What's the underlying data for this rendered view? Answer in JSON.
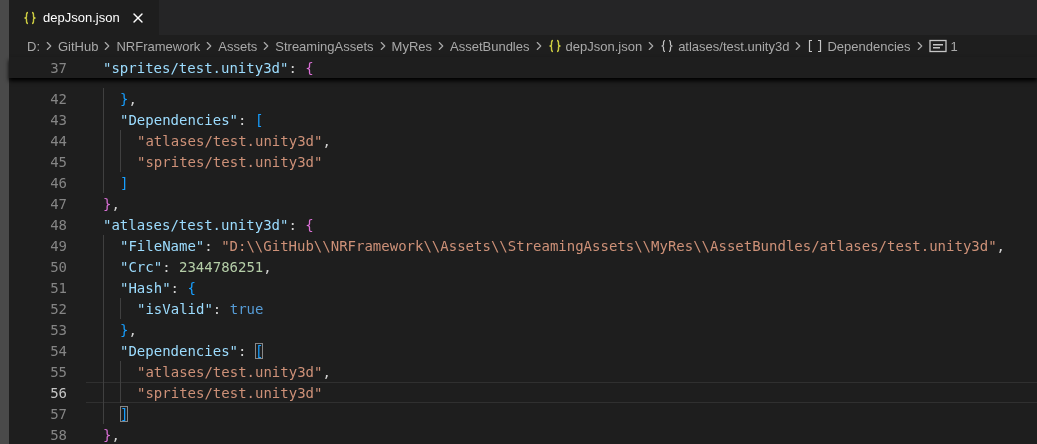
{
  "tab": {
    "title": "depJson.json",
    "selected": true
  },
  "breadcrumb": [
    {
      "kind": "folder",
      "label": "D:"
    },
    {
      "kind": "folder",
      "label": "GitHub"
    },
    {
      "kind": "folder",
      "label": "NRFramework"
    },
    {
      "kind": "folder",
      "label": "Assets"
    },
    {
      "kind": "folder",
      "label": "StreamingAssets"
    },
    {
      "kind": "folder",
      "label": "MyRes"
    },
    {
      "kind": "folder",
      "label": "AssetBundles"
    },
    {
      "kind": "file",
      "label": "depJson.json"
    },
    {
      "kind": "object",
      "label": "atlases/test.unity3d"
    },
    {
      "kind": "array",
      "label": "Dependencies"
    },
    {
      "kind": "string",
      "label": "1"
    }
  ],
  "lines": [
    {
      "number": "37",
      "sticky": true,
      "current": false,
      "tokens": [
        {
          "kind": "key",
          "text": "\"sprites/test.unity3d\""
        },
        {
          "kind": "punct",
          "text": ": "
        },
        {
          "kind": "brace1",
          "text": "{",
          "matched": false
        }
      ],
      "children": [
        {
          "number": "42",
          "sticky": false,
          "current": false,
          "tokens": [
            {
              "kind": "brace2",
              "text": "}",
              "matched": false
            },
            {
              "kind": "punct",
              "text": ","
            }
          ]
        },
        {
          "number": "43",
          "sticky": false,
          "current": false,
          "tokens": [
            {
              "kind": "key",
              "text": "\"Dependencies\""
            },
            {
              "kind": "punct",
              "text": ": "
            },
            {
              "kind": "brace2",
              "text": "[",
              "matched": false
            }
          ],
          "children": [
            {
              "number": "44",
              "sticky": false,
              "current": false,
              "tokens": [
                {
                  "kind": "string",
                  "text": "\"atlases/test.unity3d\""
                },
                {
                  "kind": "punct",
                  "text": ","
                }
              ]
            },
            {
              "number": "45",
              "sticky": false,
              "current": false,
              "tokens": [
                {
                  "kind": "string",
                  "text": "\"sprites/test.unity3d\""
                }
              ]
            }
          ]
        },
        {
          "number": "46",
          "sticky": false,
          "current": false,
          "tokens": [
            {
              "kind": "brace2",
              "text": "]",
              "matched": false
            }
          ]
        }
      ]
    },
    {
      "number": "47",
      "sticky": false,
      "current": false,
      "tokens": [
        {
          "kind": "brace1",
          "text": "}",
          "matched": false
        },
        {
          "kind": "punct",
          "text": ","
        }
      ]
    },
    {
      "number": "48",
      "sticky": false,
      "current": false,
      "tokens": [
        {
          "kind": "key",
          "text": "\"atlases/test.unity3d\""
        },
        {
          "kind": "punct",
          "text": ": "
        },
        {
          "kind": "brace1",
          "text": "{",
          "matched": false
        }
      ],
      "children": [
        {
          "number": "49",
          "sticky": false,
          "current": false,
          "tokens": [
            {
              "kind": "key",
              "text": "\"FileName\""
            },
            {
              "kind": "punct",
              "text": ": "
            },
            {
              "kind": "string",
              "text": "\"D:\\\\GitHub\\\\NRFramework\\\\Assets\\\\StreamingAssets\\\\MyRes\\\\AssetBundles/atlases/test.unity3d\""
            },
            {
              "kind": "punct",
              "text": ","
            }
          ]
        },
        {
          "number": "50",
          "sticky": false,
          "current": false,
          "tokens": [
            {
              "kind": "key",
              "text": "\"Crc\""
            },
            {
              "kind": "punct",
              "text": ": "
            },
            {
              "kind": "number",
              "text": "2344786251"
            },
            {
              "kind": "punct",
              "text": ","
            }
          ]
        },
        {
          "number": "51",
          "sticky": false,
          "current": false,
          "tokens": [
            {
              "kind": "key",
              "text": "\"Hash\""
            },
            {
              "kind": "punct",
              "text": ": "
            },
            {
              "kind": "brace2",
              "text": "{",
              "matched": false
            }
          ],
          "children": [
            {
              "number": "52",
              "sticky": false,
              "current": false,
              "tokens": [
                {
                  "kind": "key",
                  "text": "\"isValid\""
                },
                {
                  "kind": "punct",
                  "text": ": "
                },
                {
                  "kind": "bool",
                  "text": "true"
                }
              ]
            }
          ]
        },
        {
          "number": "53",
          "sticky": false,
          "current": false,
          "tokens": [
            {
              "kind": "brace2",
              "text": "}",
              "matched": false
            },
            {
              "kind": "punct",
              "text": ","
            }
          ]
        },
        {
          "number": "54",
          "sticky": false,
          "current": false,
          "tokens": [
            {
              "kind": "key",
              "text": "\"Dependencies\""
            },
            {
              "kind": "punct",
              "text": ": "
            },
            {
              "kind": "brace2",
              "text": "[",
              "matched": true
            }
          ],
          "children": [
            {
              "number": "55",
              "sticky": false,
              "current": false,
              "tokens": [
                {
                  "kind": "string",
                  "text": "\"atlases/test.unity3d\""
                },
                {
                  "kind": "punct",
                  "text": ","
                }
              ]
            },
            {
              "number": "56",
              "sticky": false,
              "current": true,
              "tokens": [
                {
                  "kind": "string",
                  "text": "\"sprites/test.unity3d\""
                }
              ]
            }
          ]
        },
        {
          "number": "57",
          "sticky": false,
          "current": false,
          "tokens": [
            {
              "kind": "brace2",
              "text": "]",
              "matched": true
            }
          ]
        }
      ]
    },
    {
      "number": "58",
      "sticky": false,
      "current": false,
      "tokens": [
        {
          "kind": "brace1",
          "text": "}",
          "matched": false
        },
        {
          "kind": "punct",
          "text": ","
        }
      ]
    }
  ]
}
